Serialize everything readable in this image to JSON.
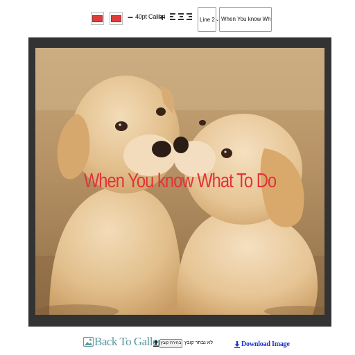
{
  "toolbar": {
    "text_color_swatch": "#e23b3b",
    "outline_color_swatch": "#e23b3b",
    "decrease_symbol": "−",
    "font_label": "40pt Calibri",
    "increase_symbol": "+",
    "align_icons": [
      "align-left-icon",
      "align-center-icon",
      "align-right-icon"
    ],
    "line_select": {
      "value": "Line 2",
      "caret": "⌄"
    },
    "text_input": {
      "value": "When You know What To Do"
    }
  },
  "canvas": {
    "overlay_text": "When You know What To Do",
    "overlay_color": "#e33238",
    "frame_color": "#333333"
  },
  "footer": {
    "back_to_gallery": "Back To Gallery",
    "gallery_icon": "image-icon",
    "upload_icon": "upload-icon",
    "choose_file_button": "בחירת קובץ",
    "no_file_label": "לא נבחר קובץ",
    "download_icon": "download-icon",
    "download_label": "Download Image"
  }
}
